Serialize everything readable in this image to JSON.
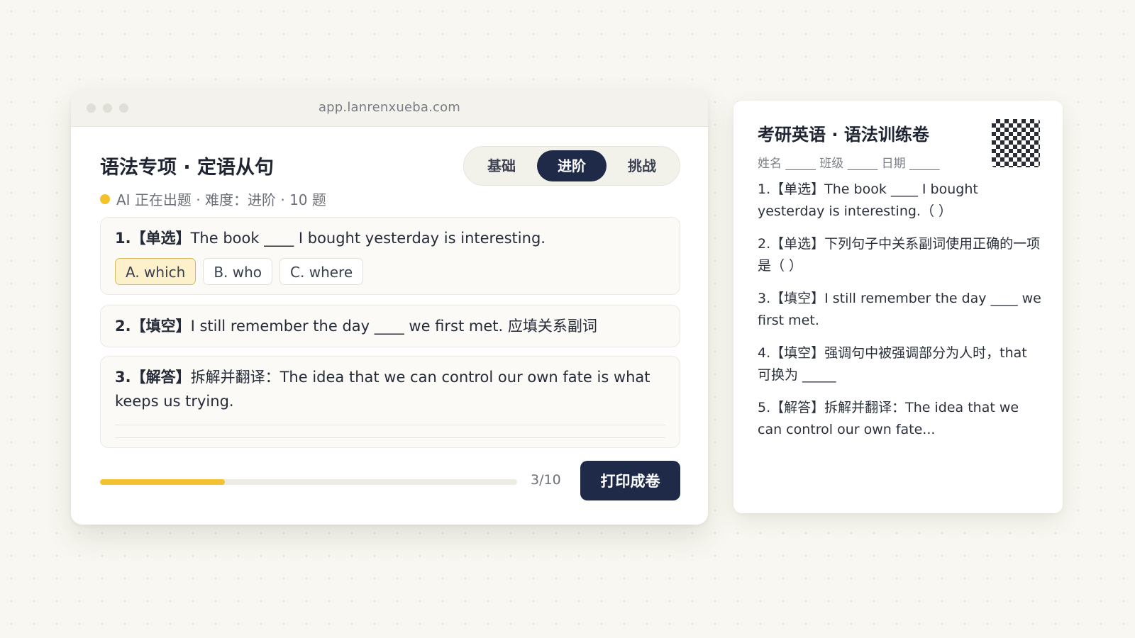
{
  "browser": {
    "url": "app.lanrenxueba.com"
  },
  "app": {
    "title": "语法专项 · 定语从句",
    "level_tabs": [
      {
        "label": "基础",
        "active": false
      },
      {
        "label": "进阶",
        "active": true
      },
      {
        "label": "挑战",
        "active": false
      }
    ],
    "status": "AI 正在出题 · 难度：进阶 · 10 题"
  },
  "questions": [
    {
      "number": "1.",
      "tag": "【单选】",
      "text": "The book ____ I bought yesterday is interesting.",
      "options": [
        {
          "label": "A. which",
          "selected": true
        },
        {
          "label": "B. who",
          "selected": false
        },
        {
          "label": "C. where",
          "selected": false
        }
      ]
    },
    {
      "number": "2.",
      "tag": "【填空】",
      "text": "I still remember the day ____ we first met. 应填关系副词"
    },
    {
      "number": "3.",
      "tag": "【解答】",
      "text": "拆解并翻译：The idea that we can control our own fate is what keeps us trying."
    }
  ],
  "progress": {
    "current": 3,
    "total": 10,
    "fraction": 0.3,
    "label": "3/10"
  },
  "actions": {
    "print_label": "打印成卷"
  },
  "paper": {
    "title": "考研英语 · 语法训练卷",
    "fields": "姓名 _____ 班级 _____ 日期 _____",
    "items": [
      "1.【单选】The book ____ I bought yesterday is interesting.（ ）",
      "2.【单选】下列句子中关系副词使用正确的一项是（ ）",
      "3.【填空】I still remember the day ____ we first met.",
      "4.【填空】强调句中被强调部分为人时，that 可换为 _____",
      "5.【解答】拆解并翻译：The idea that we can control our own fate..."
    ]
  },
  "colors": {
    "accent_dark": "#1e2a47",
    "accent_yellow": "#f4c132",
    "selected_bg": "#fdf1cc"
  }
}
